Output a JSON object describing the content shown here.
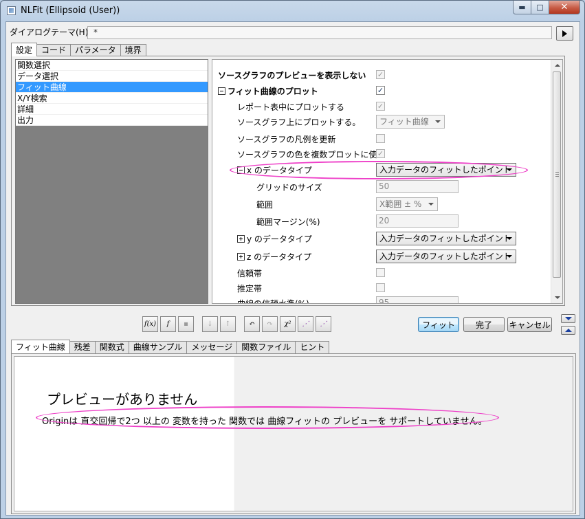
{
  "window": {
    "title": "NLFit (Ellipsoid (User))"
  },
  "theme": {
    "label": "ダイアログテーマ(H)",
    "value": "*"
  },
  "top_tabs": [
    "設定",
    "コード",
    "パラメータ",
    "境界"
  ],
  "left_list": [
    "関数選択",
    "データ選択",
    "フィット曲線",
    "X/Y検索",
    "詳細",
    "出力"
  ],
  "props": {
    "no_preview": "ソースグラフのプレビューを表示しない",
    "fit_curve_plot": "フィット曲線のプロット",
    "plot_in_report": "レポート表中にプロットする",
    "plot_on_source": "ソースグラフ上にプロットする。",
    "plot_on_source_value": "フィット曲線",
    "update_legend": "ソースグラフの凡例を更新",
    "use_source_color": "ソースグラフの色を複数プロットに使う",
    "x_datatype": "x のデータタイプ",
    "x_datatype_value": "入力データのフィットしたポイント",
    "grid_size": "グリッドのサイズ",
    "grid_size_value": "50",
    "range": "範囲",
    "range_value": "X範囲 ± %",
    "range_margin": "範囲マージン(%)",
    "range_margin_value": "20",
    "y_datatype": "y のデータタイプ",
    "y_datatype_value": "入力データのフィットしたポイント",
    "z_datatype": "z のデータタイプ",
    "z_datatype_value": "入力データのフィットしたポイント",
    "confidence_band": "信頼帯",
    "prediction_band": "推定帯",
    "confidence_level": "曲線の信頼水準(%)",
    "confidence_level_value": "95"
  },
  "toolbar_icons": [
    "fx-new-icon",
    "fx-edit-icon",
    "save-icon",
    "sort-icon",
    "sort-alt-icon",
    "undo-icon",
    "redo-icon",
    "chi-square-icon",
    "step-icon",
    "converge-icon"
  ],
  "toolbar_glyphs": [
    "f(x)",
    "f",
    "▪",
    "↓",
    "↑",
    "↶",
    "↷",
    "χ²",
    "⋰",
    "⋰"
  ],
  "buttons": {
    "fit": "フィット",
    "done": "完了",
    "cancel": "キャンセル"
  },
  "bottom_tabs": [
    "フィット曲線",
    "残差",
    "関数式",
    "曲線サンプル",
    "メッセージ",
    "関数ファイル",
    "ヒント"
  ],
  "preview": {
    "title": "プレビューがありません",
    "message": "Originは 直交回帰で2つ 以上の 変数を持った 関数では 曲線フィットの プレビューを サポートしていません。"
  },
  "colors": {
    "highlight": "#ee3fc8",
    "selection": "#3399ff"
  }
}
